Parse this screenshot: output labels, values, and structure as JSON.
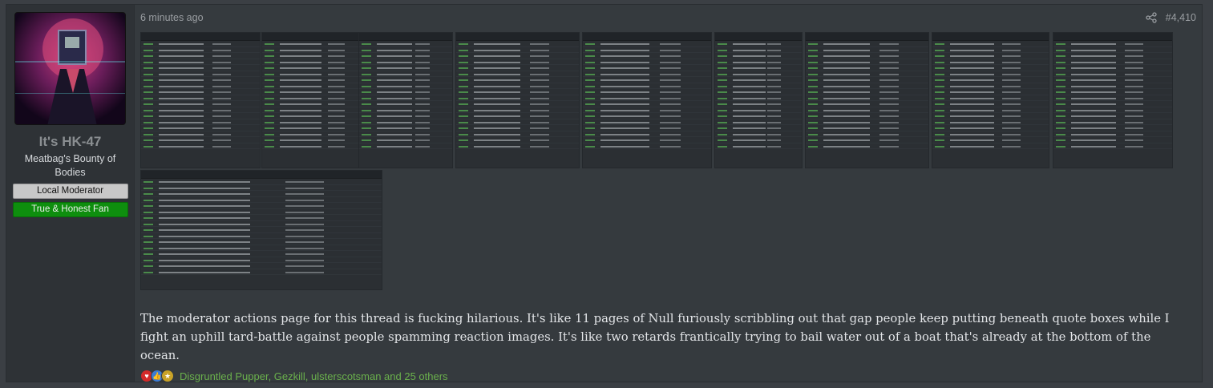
{
  "user": {
    "name": "It's HK-47",
    "title": "Meatbag's Bounty of Bodies",
    "banners": [
      "Local Moderator",
      "True & Honest Fan"
    ]
  },
  "post": {
    "time": "6 minutes ago",
    "number": "#4,410",
    "body": "The moderator actions page for this thread is fucking hilarious. It's like 11 pages of Null furiously scribbling out that gap people keep putting beneath quote boxes while I fight an uphill tard-battle against people spamming reaction images. It's like two retards frantically trying to bail water out of a boat that's already at the bottom of the ocean.",
    "reactions_text": "Disgruntled Pupper, Gezkill, ulsterscotsman and 25 others",
    "reaction_icons": [
      "heart-icon",
      "like-icon",
      "award-icon"
    ]
  },
  "colors": {
    "page_bg": "#3b3f44",
    "post_bg": "#353a3e",
    "user_bg": "#2e3236",
    "fan_banner": "#0e8e0e",
    "mod_banner": "#c8c8c8",
    "reaction_link": "#6ab04c"
  }
}
